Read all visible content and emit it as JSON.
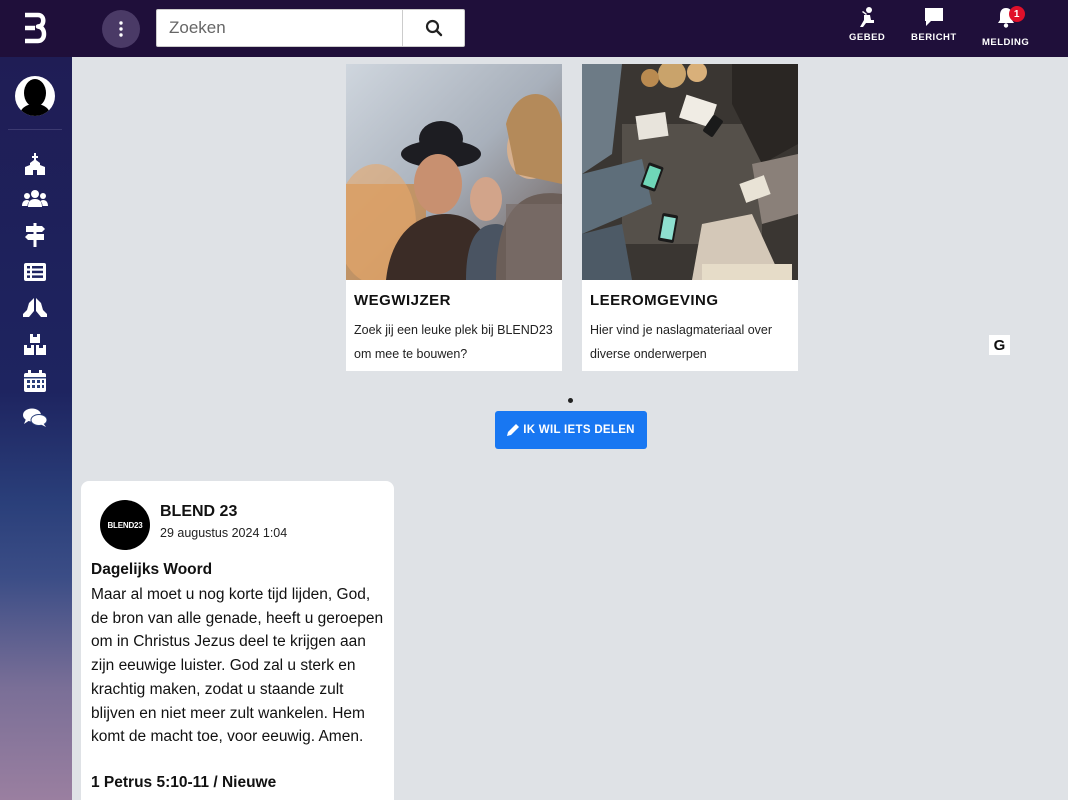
{
  "topbar": {
    "search": {
      "placeholder": "Zoeken"
    },
    "actions": [
      {
        "label": "GEBED",
        "icon": "praying-person-icon"
      },
      {
        "label": "BERICHT",
        "icon": "message-icon"
      },
      {
        "label": "MELDING",
        "icon": "bell-icon",
        "badge": "1"
      }
    ]
  },
  "sidebar": {
    "items": [
      {
        "icon": "church-icon"
      },
      {
        "icon": "users-icon"
      },
      {
        "icon": "signpost-icon"
      },
      {
        "icon": "list-icon"
      },
      {
        "icon": "praying-hands-icon"
      },
      {
        "icon": "boxes-icon"
      },
      {
        "icon": "calendar-icon"
      },
      {
        "icon": "comments-icon"
      }
    ]
  },
  "cards": [
    {
      "title": "WEGWIJZER",
      "description": "Zoek jij een leuke plek bij BLEND23 om mee te bouwen?"
    },
    {
      "title": "LEEROMGEVING",
      "description": "Hier vind je naslagmateriaal over diverse onderwerpen"
    }
  ],
  "g_badge": "G",
  "share_button": {
    "label": "IK WIL IETS DELEN"
  },
  "post": {
    "avatar_text": "BLEND23",
    "author": "BLEND 23",
    "date": "29 augustus 2024 1:04",
    "heading": "Dagelijks Woord",
    "body": "Maar al moet u nog korte tijd lijden, God, de bron van alle genade, heeft u geroepen om in Christus Jezus deel te krijgen aan zijn eeuwige luister. God zal u sterk en krachtig maken, zodat u staande zult blijven en niet meer zult wankelen. Hem komt de macht toe, voor eeuwig. Amen.",
    "reference": "1 Petrus 5:10-11 / Nieuwe"
  },
  "colors": {
    "topbar": "#1f0f3a",
    "accent": "#1877f2",
    "badge": "#e0102a"
  }
}
